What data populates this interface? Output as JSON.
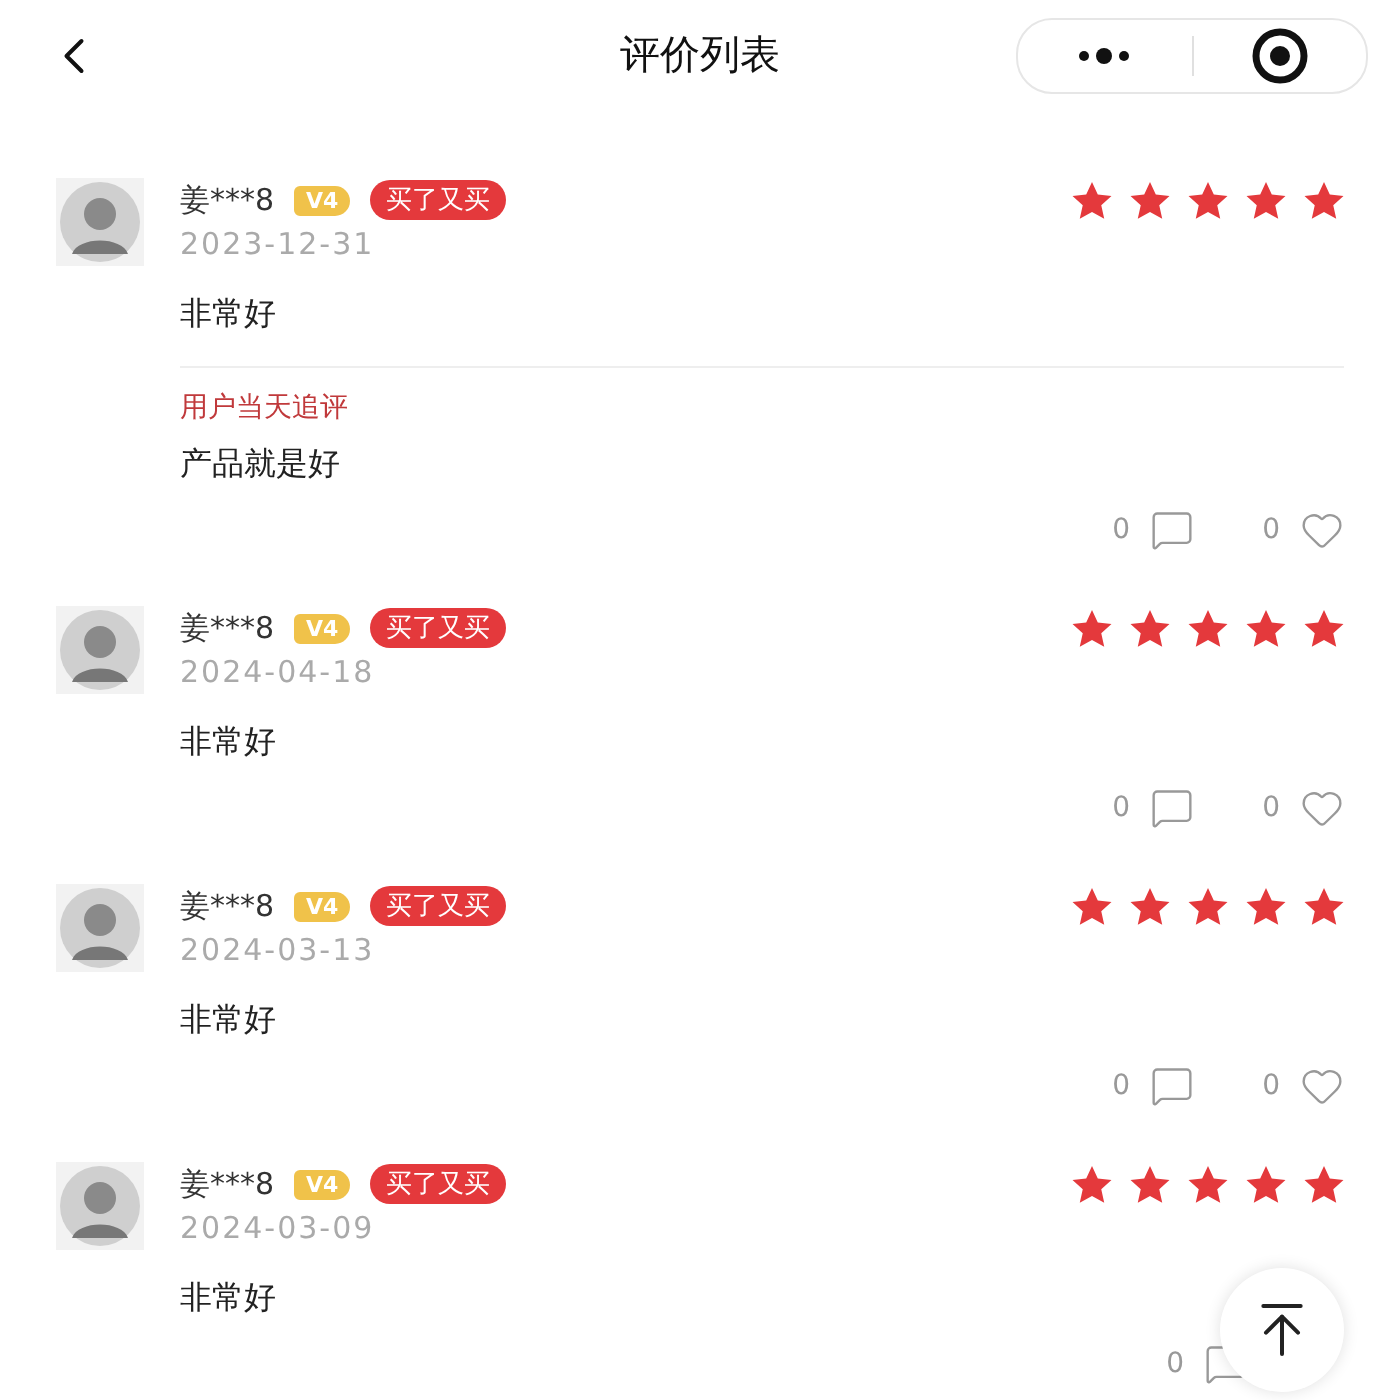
{
  "header": {
    "title": "评价列表"
  },
  "reviews": [
    {
      "user": "姜***8",
      "level_badge": "V4",
      "tag": "买了又买",
      "date": "2023-12-31",
      "stars": 5,
      "content": "非常好",
      "followup": {
        "label": "用户当天追评",
        "content": "产品就是好"
      },
      "comment_count": "0",
      "like_count": "0"
    },
    {
      "user": "姜***8",
      "level_badge": "V4",
      "tag": "买了又买",
      "date": "2024-04-18",
      "stars": 5,
      "content": "非常好",
      "comment_count": "0",
      "like_count": "0"
    },
    {
      "user": "姜***8",
      "level_badge": "V4",
      "tag": "买了又买",
      "date": "2024-03-13",
      "stars": 5,
      "content": "非常好",
      "comment_count": "0",
      "like_count": "0"
    },
    {
      "user": "姜***8",
      "level_badge": "V4",
      "tag": "买了又买",
      "date": "2024-03-09",
      "stars": 5,
      "content": "非常好",
      "comment_count": "0"
    }
  ]
}
